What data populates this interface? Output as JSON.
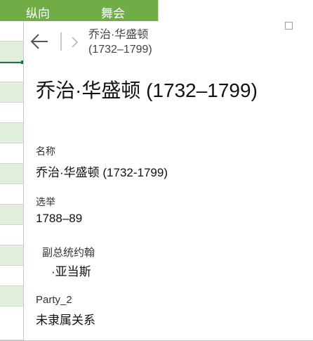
{
  "sheet": {
    "column_headers": [
      "纵向",
      "舞会"
    ]
  },
  "card": {
    "breadcrumb": "乔治·华盛顿\n(1732–1799)",
    "title": "乔治·华盛顿 (1732–1799)",
    "fields": {
      "name": {
        "label": "名称",
        "value": "乔治·华盛顿 (1732-1799)"
      },
      "elected": {
        "label": "选举",
        "value": "1788–89"
      },
      "vice_president": {
        "label": "副总统约翰",
        "value": "·亚当斯"
      },
      "party": {
        "label": "Party_2",
        "value": "未隶属关系"
      }
    }
  },
  "colors": {
    "header_green": "#70ad47",
    "row_green": "#e2efda",
    "active_cell": "#217346"
  },
  "icons": [
    "back-arrow-icon",
    "forward-chevron-icon",
    "resize-handle-icon"
  ]
}
